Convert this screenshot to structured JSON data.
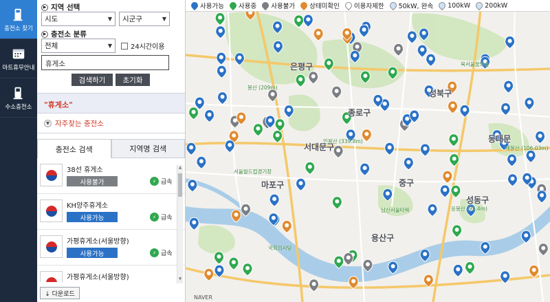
{
  "sidebar": {
    "items": [
      {
        "label": "충전소 찾기",
        "active": true
      },
      {
        "label": "마트휴무안내",
        "active": false
      },
      {
        "label": "수소충전소",
        "active": false
      }
    ]
  },
  "search": {
    "region_title": "지역 선택",
    "sido": "시도",
    "sigungu": "시군구",
    "type_title": "충전소 분류",
    "type_value": "전체",
    "open24_label": "24시간이용",
    "keyword": "휴게소",
    "search_button": "검색하기",
    "reset_button": "초기화"
  },
  "result_label": "\"휴게소\"",
  "favorites_label": "자주찾는 충전소",
  "tabs": [
    {
      "label": "충전소 검색",
      "active": true
    },
    {
      "label": "지역명 검색",
      "active": false
    }
  ],
  "results": [
    {
      "name": "38선 휴게소",
      "status": "사용불가",
      "status_kind": "unavail",
      "speed": "급속"
    },
    {
      "name": "KH양주휴게소",
      "status": "사용가능",
      "status_kind": "avail",
      "speed": "급속"
    },
    {
      "name": "가평휴게소(서울방향)",
      "status": "사용가능",
      "status_kind": "avail",
      "speed": "급속"
    },
    {
      "name": "가평휴게소(서울방향)",
      "status": "",
      "status_kind": "",
      "speed": ""
    }
  ],
  "download_label": "↓ 다운로드",
  "legend": [
    {
      "label": "사용가능",
      "color": "#2b72c6"
    },
    {
      "label": "사용중",
      "color": "#2fa84f"
    },
    {
      "label": "사용불가",
      "color": "#7b7e83"
    },
    {
      "label": "상태미확인",
      "color": "#e08a2f"
    },
    {
      "label": "이용자제한",
      "color": "#ffffff"
    },
    {
      "label": "50kW, 완속",
      "color": "#cfe3f7"
    },
    {
      "label": "100kW",
      "color": "#cfe3f7"
    },
    {
      "label": "200kW",
      "color": "#cfe3f7"
    }
  ],
  "map_labels": [
    {
      "text": "은평구"
    },
    {
      "text": "성북구"
    },
    {
      "text": "종로구"
    },
    {
      "text": "서대문구"
    },
    {
      "text": "동대문"
    },
    {
      "text": "마포구"
    },
    {
      "text": "중구"
    },
    {
      "text": "성동구"
    },
    {
      "text": "용산구"
    }
  ],
  "map_sub_labels": [
    {
      "text": "북서울꿈의숲"
    },
    {
      "text": "봉산 (209m)"
    },
    {
      "text": "인왕산 (339.8m)"
    },
    {
      "text": "배봉산 (106.03m)"
    },
    {
      "text": "남산서울타워"
    },
    {
      "text": "응봉산 (95.4m)"
    },
    {
      "text": "서울월드컵경기장"
    },
    {
      "text": "국회의사당"
    }
  ],
  "attribution": "NAVER"
}
